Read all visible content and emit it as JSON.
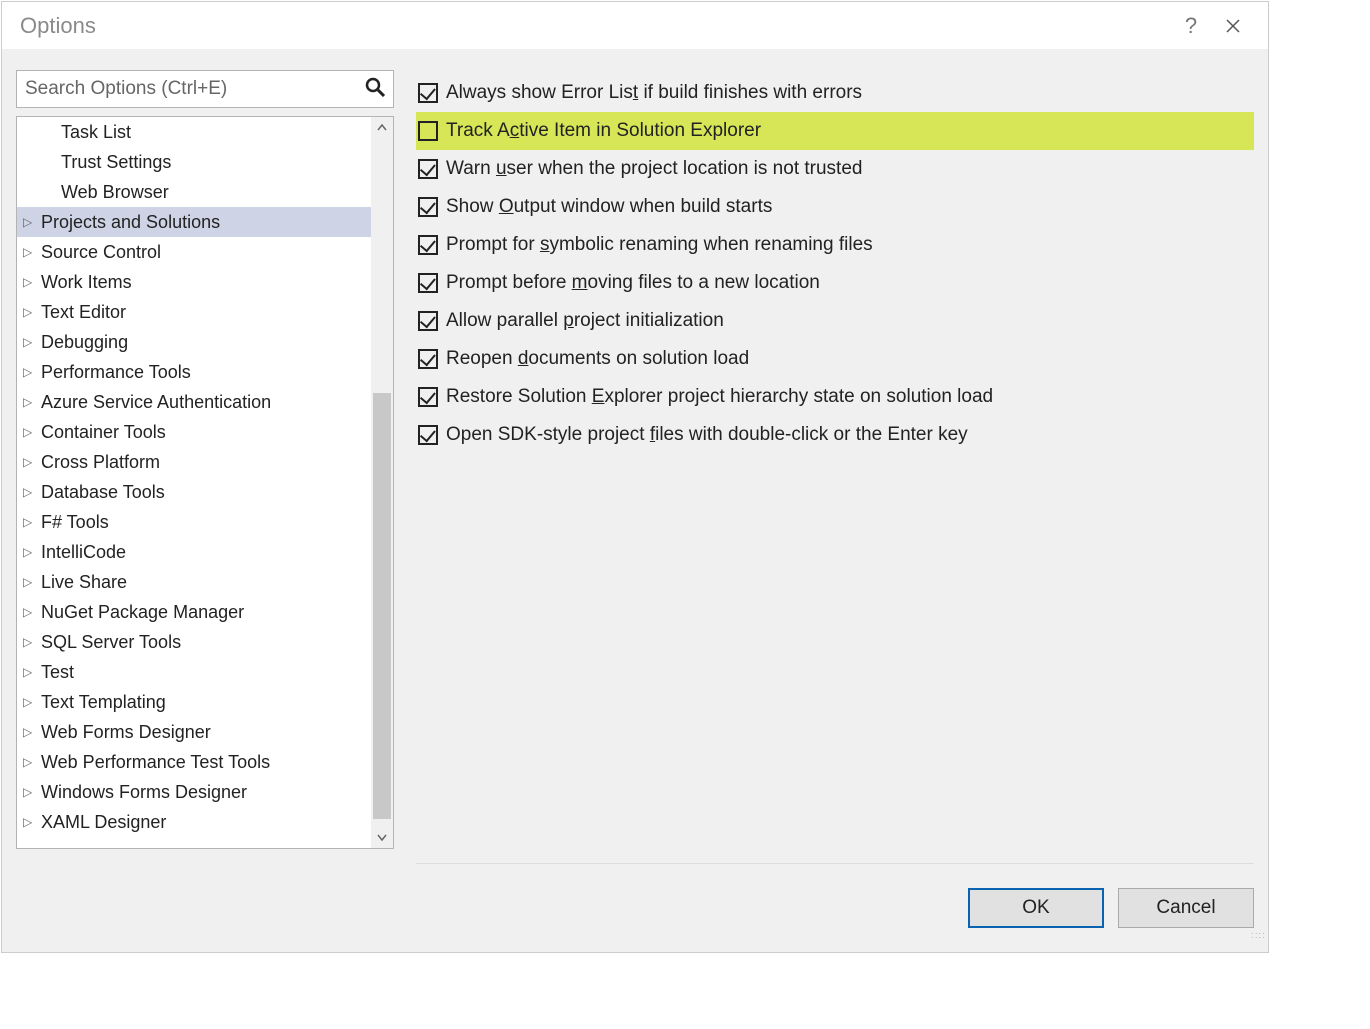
{
  "window": {
    "title": "Options"
  },
  "search": {
    "placeholder": "Search Options (Ctrl+E)"
  },
  "tree": {
    "items": [
      {
        "label": "Task List",
        "indent": 2,
        "expander": "",
        "selected": false
      },
      {
        "label": "Trust Settings",
        "indent": 2,
        "expander": "",
        "selected": false
      },
      {
        "label": "Web Browser",
        "indent": 2,
        "expander": "",
        "selected": false
      },
      {
        "label": "Projects and Solutions",
        "indent": 0,
        "expander": "▷",
        "selected": true
      },
      {
        "label": "Source Control",
        "indent": 0,
        "expander": "▷",
        "selected": false
      },
      {
        "label": "Work Items",
        "indent": 0,
        "expander": "▷",
        "selected": false
      },
      {
        "label": "Text Editor",
        "indent": 0,
        "expander": "▷",
        "selected": false
      },
      {
        "label": "Debugging",
        "indent": 0,
        "expander": "▷",
        "selected": false
      },
      {
        "label": "Performance Tools",
        "indent": 0,
        "expander": "▷",
        "selected": false
      },
      {
        "label": "Azure Service Authentication",
        "indent": 0,
        "expander": "▷",
        "selected": false
      },
      {
        "label": "Container Tools",
        "indent": 0,
        "expander": "▷",
        "selected": false
      },
      {
        "label": "Cross Platform",
        "indent": 0,
        "expander": "▷",
        "selected": false
      },
      {
        "label": "Database Tools",
        "indent": 0,
        "expander": "▷",
        "selected": false
      },
      {
        "label": "F# Tools",
        "indent": 0,
        "expander": "▷",
        "selected": false
      },
      {
        "label": "IntelliCode",
        "indent": 0,
        "expander": "▷",
        "selected": false
      },
      {
        "label": "Live Share",
        "indent": 0,
        "expander": "▷",
        "selected": false
      },
      {
        "label": "NuGet Package Manager",
        "indent": 0,
        "expander": "▷",
        "selected": false
      },
      {
        "label": "SQL Server Tools",
        "indent": 0,
        "expander": "▷",
        "selected": false
      },
      {
        "label": "Test",
        "indent": 0,
        "expander": "▷",
        "selected": false
      },
      {
        "label": "Text Templating",
        "indent": 0,
        "expander": "▷",
        "selected": false
      },
      {
        "label": "Web Forms Designer",
        "indent": 0,
        "expander": "▷",
        "selected": false
      },
      {
        "label": "Web Performance Test Tools",
        "indent": 0,
        "expander": "▷",
        "selected": false
      },
      {
        "label": "Windows Forms Designer",
        "indent": 0,
        "expander": "▷",
        "selected": false
      },
      {
        "label": "XAML Designer",
        "indent": 0,
        "expander": "▷",
        "selected": false
      }
    ]
  },
  "checks": {
    "items": [
      {
        "text": "Always show Error Lis<u>t</u> if build finishes with errors",
        "checked": true,
        "highlight": false
      },
      {
        "text": "Track A<u>c</u>tive Item in Solution Explorer",
        "checked": false,
        "highlight": true
      },
      {
        "text": "Warn <u>u</u>ser when the project location is not trusted",
        "checked": true,
        "highlight": false
      },
      {
        "text": "Show <u>O</u>utput window when build starts",
        "checked": true,
        "highlight": false
      },
      {
        "text": "Prompt for <u>s</u>ymbolic renaming when renaming files",
        "checked": true,
        "highlight": false
      },
      {
        "text": "Prompt before <u>m</u>oving files to a new location",
        "checked": true,
        "highlight": false
      },
      {
        "text": "Allow parallel <u>p</u>roject initialization",
        "checked": true,
        "highlight": false
      },
      {
        "text": "Reopen <u>d</u>ocuments on solution load",
        "checked": true,
        "highlight": false
      },
      {
        "text": "Restore Solution <u>E</u>xplorer project hierarchy state on solution load",
        "checked": true,
        "highlight": false
      },
      {
        "text": "Open SDK-style project <u>f</u>iles with double-click or the Enter key",
        "checked": true,
        "highlight": false
      }
    ]
  },
  "buttons": {
    "ok": "OK",
    "cancel": "Cancel"
  }
}
